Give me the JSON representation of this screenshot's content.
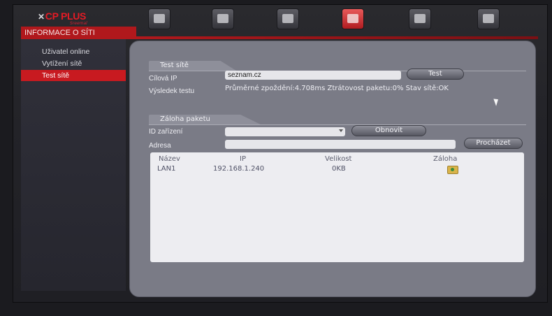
{
  "brand": {
    "logo": "CP PLUS",
    "sub": "Sreemal"
  },
  "header": {
    "title": "INFORMACE O SÍTI"
  },
  "toolbar_icons": [
    "camera-icon",
    "video-icon",
    "storage-icon",
    "network-icon",
    "tools-icon",
    "shutdown-icon"
  ],
  "sidebar": {
    "items": [
      {
        "label": "Uživatel online"
      },
      {
        "label": "Vytížení sítě"
      },
      {
        "label": "Test sítě"
      }
    ],
    "active": "Test sítě"
  },
  "test_section": {
    "title": "Test sítě",
    "target_label": "Cílová IP",
    "target_value": "seznam.cz",
    "test_button": "Test",
    "result_label": "Výsledek testu",
    "result_value": "Průměrné zpoždění:4.708ms  Ztrátovost paketu:0%  Stav sítě:OK"
  },
  "backup_section": {
    "title": "Záloha paketu",
    "device_label": "ID zařízení",
    "device_value": "",
    "refresh_button": "Obnovit",
    "address_label": "Adresa",
    "address_value": "",
    "browse_button": "Procházet"
  },
  "table": {
    "headers": {
      "name": "Název",
      "ip": "IP",
      "size": "Velikost",
      "backup": "Záloha"
    },
    "rows": [
      {
        "name": "LAN1",
        "ip": "192.168.1.240",
        "size": "0KB",
        "backup_icon": "backup-icon"
      }
    ]
  }
}
